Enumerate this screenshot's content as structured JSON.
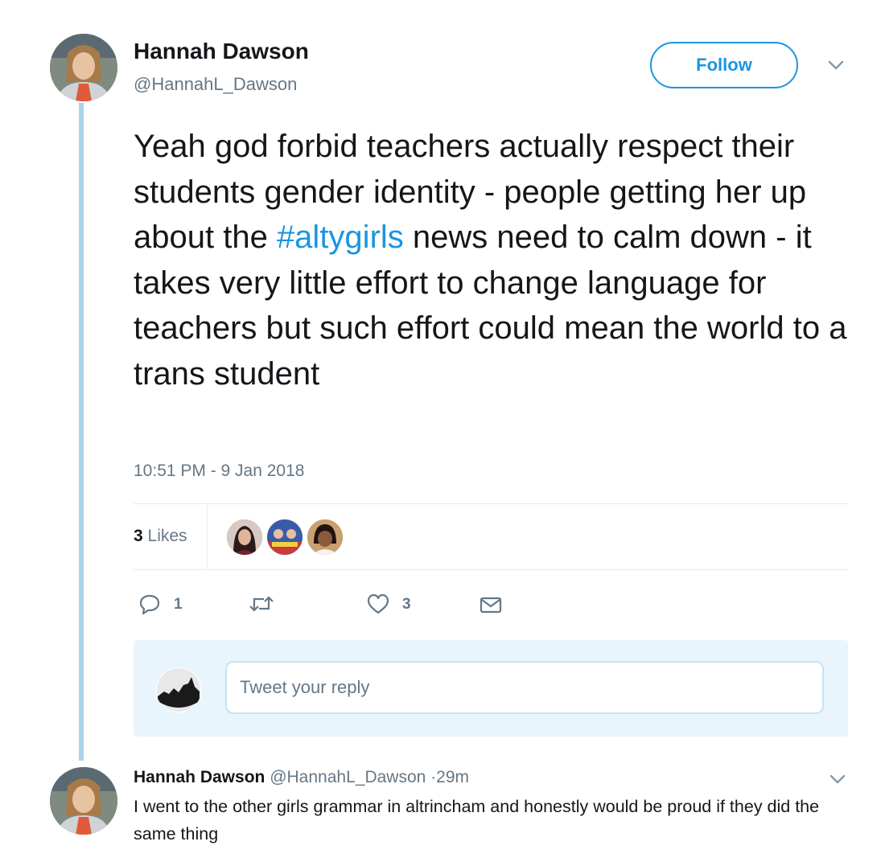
{
  "tweet": {
    "author": {
      "name": "Hannah Dawson",
      "handle": "@HannahL_Dawson"
    },
    "follow_label": "Follow",
    "text_before_hashtag": "Yeah god forbid teachers actually respect their students gender identity - people getting her up about the ",
    "hashtag": "#altygirls",
    "text_after_hashtag": " news need to calm down - it takes very little effort to change language for teachers but such effort could mean the world to a trans student",
    "timestamp": "10:51 PM - 9 Jan 2018",
    "likes_count": "3",
    "likes_label": " Likes",
    "actions": {
      "replies": "1",
      "retweets": "",
      "likes": "3"
    }
  },
  "reply_box": {
    "placeholder": "Tweet your reply"
  },
  "reply": {
    "name": "Hannah Dawson",
    "handle": "@HannahL_Dawson",
    "time": "·29m",
    "text": "I went to the other girls grammar in altrincham and honestly would be proud if they did the same thing"
  },
  "colors": {
    "accent": "#1b95e0",
    "thread_line": "#a9d4ea",
    "muted": "#657786",
    "reply_box_bg": "#e8f5fd"
  },
  "icons": [
    "reply-icon",
    "retweet-icon",
    "heart-icon",
    "envelope-icon",
    "chevron-down-icon"
  ]
}
